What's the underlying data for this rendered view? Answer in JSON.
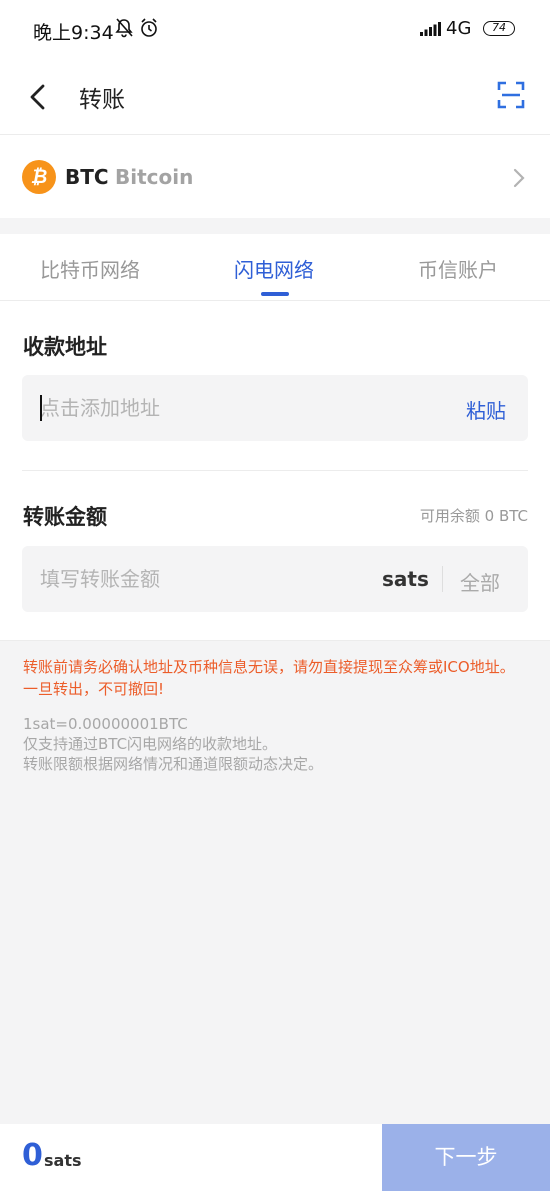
{
  "status_bar": {
    "time": "晚上9:34",
    "network": "4G",
    "battery": "74"
  },
  "header": {
    "title": "转账"
  },
  "coin": {
    "symbol": "BTC",
    "name": "Bitcoin",
    "logo_glyph": "₿",
    "brand_color": "#f7931a"
  },
  "tabs": [
    {
      "label": "比特币网络",
      "active": false
    },
    {
      "label": "闪电网络",
      "active": true
    },
    {
      "label": "币信账户",
      "active": false
    }
  ],
  "address": {
    "label": "收款地址",
    "placeholder": "点击添加地址",
    "value": "",
    "paste_label": "粘贴"
  },
  "amount": {
    "label": "转账金额",
    "available": "可用余额 0 BTC",
    "placeholder": "填写转账金额",
    "unit": "sats",
    "all_label": "全部"
  },
  "warning": "转账前请务必确认地址及币种信息无误，请勿直接提现至众筹或ICO地址。一旦转出，不可撤回!",
  "notes": [
    "1sat=0.00000001BTC",
    "仅支持通过BTC闪电网络的收款地址。",
    "转账限额根据网络情况和通道限额动态决定。"
  ],
  "footer": {
    "amount_value": "0",
    "amount_unit": "sats",
    "next_label": "下一步"
  },
  "colors": {
    "accent": "#2f5fd6",
    "warning": "#ec5d2a",
    "button_disabled": "#9bb1e9"
  },
  "icons": [
    "bell-off-icon",
    "alarm-icon",
    "signal-icon",
    "battery-icon",
    "back-arrow-icon",
    "scan-icon",
    "bitcoin-icon",
    "chevron-right-icon"
  ]
}
